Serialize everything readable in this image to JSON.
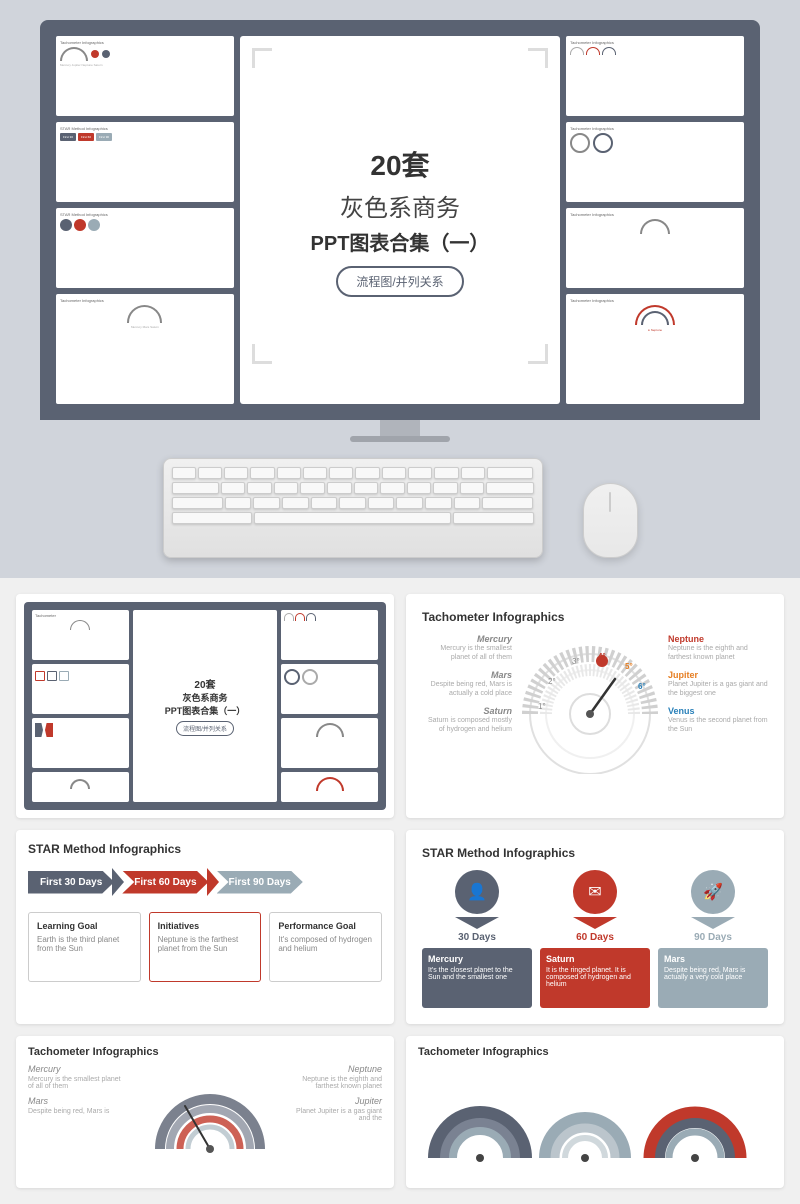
{
  "header": {
    "title_zh_line1": "20套",
    "title_zh_line2": "灰色系商务",
    "title_zh_line3": "PPT图表合集（一）",
    "subtitle": "流程图/并列关系"
  },
  "tachometer": {
    "section_title": "Tachometer Infographics",
    "planets": [
      {
        "name": "Mercury",
        "angle": "3°",
        "desc": "Mercury is the smallest planet of all of them",
        "color": "left"
      },
      {
        "name": "Mars",
        "angle": "2°",
        "desc": "Despite being red, Mars is actually a cold place",
        "color": "left"
      },
      {
        "name": "Saturn",
        "angle": "1°",
        "desc": "Saturn is composed mostly of hydrogen and helium",
        "color": "left"
      },
      {
        "name": "Neptune",
        "angle": "4°",
        "desc": "Neptune is the eighth and farthest known planet",
        "color": "red"
      },
      {
        "name": "Jupiter",
        "angle": "5°",
        "desc": "Planet Jupiter is a gas giant and the biggest one",
        "color": "orange"
      },
      {
        "name": "Venus",
        "angle": "6°",
        "desc": "Venus is the second planet from the Sun",
        "color": "blue"
      }
    ]
  },
  "star_method_1": {
    "section_title": "STAR Method Infographics",
    "steps": [
      {
        "label": "First 30 Days",
        "style": "gray"
      },
      {
        "label": "First 60 Days",
        "style": "red"
      },
      {
        "label": "First 90 Days",
        "style": "light"
      }
    ],
    "boxes": [
      {
        "title": "Learning Goal",
        "desc": "Earth is the third planet from the Sun",
        "style": "normal"
      },
      {
        "title": "Initiatives",
        "desc": "Neptune is the farthest planet from the Sun",
        "style": "red"
      },
      {
        "title": "Performance Goal",
        "desc": "It's composed of hydrogen and helium",
        "style": "normal"
      }
    ]
  },
  "star_method_2": {
    "section_title": "STAR Method Infographics",
    "steps": [
      {
        "label": "30 Days",
        "icon": "person-icon",
        "style": "dark"
      },
      {
        "label": "60 Days",
        "icon": "mail-icon",
        "style": "red"
      },
      {
        "label": "90 Days",
        "icon": "rocket-icon",
        "style": "light"
      }
    ],
    "contents": [
      {
        "planet": "Mercury",
        "desc": "It's the closest planet to the Sun and the smallest one",
        "style": "dark"
      },
      {
        "planet": "Saturn",
        "desc": "It is the ringed planet. It is composed of hydrogen and helium",
        "style": "red"
      },
      {
        "planet": "Mars",
        "desc": "Despite being red, Mars is actually a very cold place",
        "style": "light"
      }
    ]
  },
  "tachometer_bottom_left": {
    "section_title": "Tachometer Infographics",
    "mercury_label": "Mercury",
    "mercury_desc": "Mercury is the smallest planet of all of them",
    "mars_label": "Mars",
    "mars_desc": "Despite being red, Mars is",
    "neptune_label": "Neptune",
    "neptune_desc": "Neptune is the eighth and farthest known planet",
    "jupiter_label": "Jupiter",
    "jupiter_desc": "Planet Jupiter is a gas giant and the"
  },
  "tachometer_bottom_right": {
    "section_title": "Tachometer Infographics"
  }
}
